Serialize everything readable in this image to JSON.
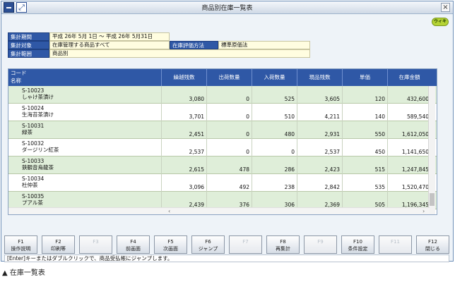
{
  "window": {
    "title": "商品別在庫一覧表",
    "close_glyph": "×",
    "expand_glyph": "⤢"
  },
  "wiki_button": {
    "label": "ウィキ"
  },
  "summary": {
    "period_label": "集計期間",
    "period_value": "平成 26年 5月 1日 〜 平成 26年 5月31日",
    "target_label": "集計対象",
    "target_value": "在庫管理する商品すべて",
    "method_label": "在庫評価方法",
    "method_value": "標準原価法",
    "unit_label": "集計範囲",
    "unit_value": "商品別"
  },
  "table": {
    "headers": {
      "code": "コード",
      "name": "名称",
      "carry": "繰越残数",
      "out": "出荷数量",
      "in": "入荷数量",
      "current": "現品残数",
      "price": "単価",
      "amount": "在庫金額"
    },
    "rows": [
      {
        "code": "S-10023",
        "name": "しゃけ茶漬け",
        "carry": "3,080",
        "out": "0",
        "in": "525",
        "current": "3,605",
        "price": "120",
        "amount": "432,600"
      },
      {
        "code": "S-10024",
        "name": "生海苔茶漬け",
        "carry": "3,701",
        "out": "0",
        "in": "510",
        "current": "4,211",
        "price": "140",
        "amount": "589,540"
      },
      {
        "code": "S-10031",
        "name": "緑茶",
        "carry": "2,451",
        "out": "0",
        "in": "480",
        "current": "2,931",
        "price": "550",
        "amount": "1,612,050"
      },
      {
        "code": "S-10032",
        "name": "ダージリン紅茶",
        "carry": "2,537",
        "out": "0",
        "in": "0",
        "current": "2,537",
        "price": "450",
        "amount": "1,141,650"
      },
      {
        "code": "S-10033",
        "name": "鉄観音烏龍茶",
        "carry": "2,615",
        "out": "478",
        "in": "286",
        "current": "2,423",
        "price": "515",
        "amount": "1,247,845"
      },
      {
        "code": "S-10034",
        "name": "杜仲茶",
        "carry": "3,096",
        "out": "492",
        "in": "238",
        "current": "2,842",
        "price": "535",
        "amount": "1,520,470"
      },
      {
        "code": "S-10035",
        "name": "プアル茶",
        "carry": "2,439",
        "out": "376",
        "in": "306",
        "current": "2,369",
        "price": "505",
        "amount": "1,196,345"
      }
    ]
  },
  "fkeys": [
    {
      "key": "F1",
      "label": "操作説明",
      "enabled": true
    },
    {
      "key": "F2",
      "label": "印刷等",
      "enabled": true
    },
    {
      "key": "F3",
      "label": "",
      "enabled": false
    },
    {
      "key": "F4",
      "label": "前画面",
      "enabled": true
    },
    {
      "key": "F5",
      "label": "次画面",
      "enabled": true
    },
    {
      "key": "F6",
      "label": "ジャンプ",
      "enabled": true
    },
    {
      "key": "F7",
      "label": "",
      "enabled": false
    },
    {
      "key": "F8",
      "label": "再集計",
      "enabled": true
    },
    {
      "key": "F9",
      "label": "",
      "enabled": false
    },
    {
      "key": "F10",
      "label": "条件設定",
      "enabled": true
    },
    {
      "key": "F11",
      "label": "",
      "enabled": false
    },
    {
      "key": "F12",
      "label": "閉じる",
      "enabled": true
    }
  ],
  "statusbar": {
    "text": "[Enter]キーまたはダブルクリックで、商品受払帳にジャンプします。"
  },
  "caption": {
    "text": "▲ 在庫一覧表"
  },
  "colors": {
    "accent": "#2f58a6",
    "row_green": "#dfeed9",
    "summary_value_bg": "#fffde0"
  }
}
